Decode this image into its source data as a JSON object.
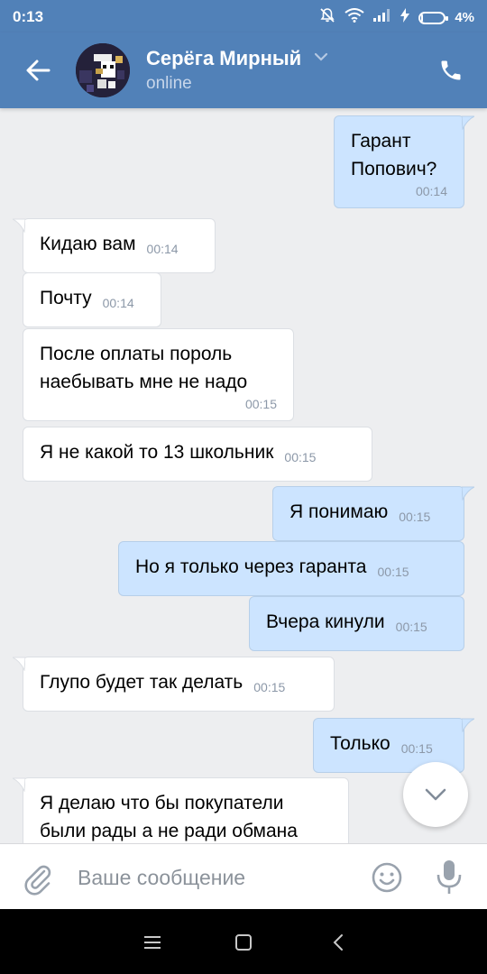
{
  "status_bar": {
    "time": "0:13",
    "battery_percent": "4%",
    "battery_level": 0.04
  },
  "header": {
    "contact_name": "Серёга Мирный",
    "contact_status": "online",
    "icons": [
      "back-arrow-icon",
      "chevron-down-icon",
      "phone-icon"
    ]
  },
  "messages": [
    {
      "dir": "out",
      "text": "Гарант\nПопович?",
      "time": "00:14"
    },
    {
      "dir": "in",
      "text": "Кидаю вам",
      "time": "00:14"
    },
    {
      "dir": "in",
      "text": "Почту",
      "time": "00:14"
    },
    {
      "dir": "in",
      "text": "После оплаты пороль\nнаебывать мне не надо",
      "time": "00:15"
    },
    {
      "dir": "in",
      "text": "Я не какой то 13 школьник",
      "time": "00:15"
    },
    {
      "dir": "out",
      "text": "Я понимаю",
      "time": "00:15"
    },
    {
      "dir": "out",
      "text": "Но я только через гаранта",
      "time": "00:15"
    },
    {
      "dir": "out",
      "text": "Вчера кинули",
      "time": "00:15"
    },
    {
      "dir": "in",
      "text": "Глупо будет так делать",
      "time": "00:15"
    },
    {
      "dir": "out",
      "text": "Только",
      "time": "00:15"
    },
    {
      "dir": "in",
      "text": "Я делаю что бы покупатели\nбыли рады а не ради обмана",
      "time": ""
    }
  ],
  "composer": {
    "placeholder": "Ваше сообщение",
    "icons": [
      "paperclip-icon",
      "smiley-icon",
      "microphone-icon"
    ]
  },
  "colors": {
    "header": "#5181b8",
    "chat_background": "#edeef0",
    "incoming_bubble": "#ffffff",
    "outgoing_bubble": "#cce4ff",
    "timestamp": "#8c98a8"
  }
}
